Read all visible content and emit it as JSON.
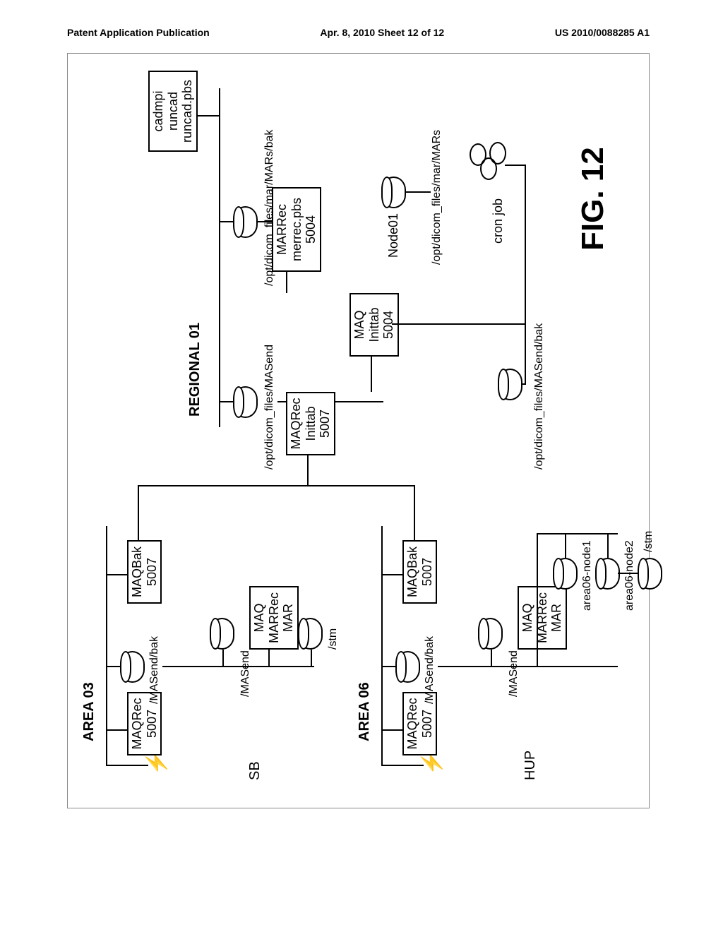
{
  "header": {
    "left": "Patent Application Publication",
    "mid": "Apr. 8, 2010  Sheet 12 of 12",
    "right": "US 2010/0088285 A1"
  },
  "figure_label": "FIG. 12",
  "area03": {
    "title": "AREA 03",
    "external": "SB",
    "maqrec": "MAQRec\n5007",
    "maqbak": "MAQBak\n5007",
    "dir_send_bak": "/MASend/bak",
    "dir_send": "/MASend",
    "dir_stm": "/stm",
    "svc": "MAQ\nMARRec\nMAR"
  },
  "area06": {
    "title": "AREA 06",
    "external": "HUP",
    "maqrec": "MAQRec\n5007",
    "maqbak": "MAQBak\n5007",
    "dir_send_bak": "/MASend/bak",
    "dir_send": "/MASend",
    "dir_stm": "/stm",
    "svc": "MAQ\nMARRec\nMAR",
    "node1": "area06-node1",
    "node2": "area06-node2"
  },
  "regional": {
    "title": "REGIONAL 01",
    "dir_masend": "/opt/dicom_files/MASend",
    "maqrec": "MAQRec\nInittab\n5007",
    "maq": "MAQ\nInittab\n5004",
    "marrec": "MARRec\nmerrec.pbs\n5004",
    "dir_mars": "/opt/dicom_files/mar/MARs/bak",
    "scripts": "cadmpi\nruncad\nruncad.pbs",
    "node01": "Node01",
    "dir_mars2": "/opt/dicom_files/mar/MARs",
    "dir_masend_bak": "/opt/dicom_files/MASend/bak",
    "cronjob": "cron job"
  }
}
